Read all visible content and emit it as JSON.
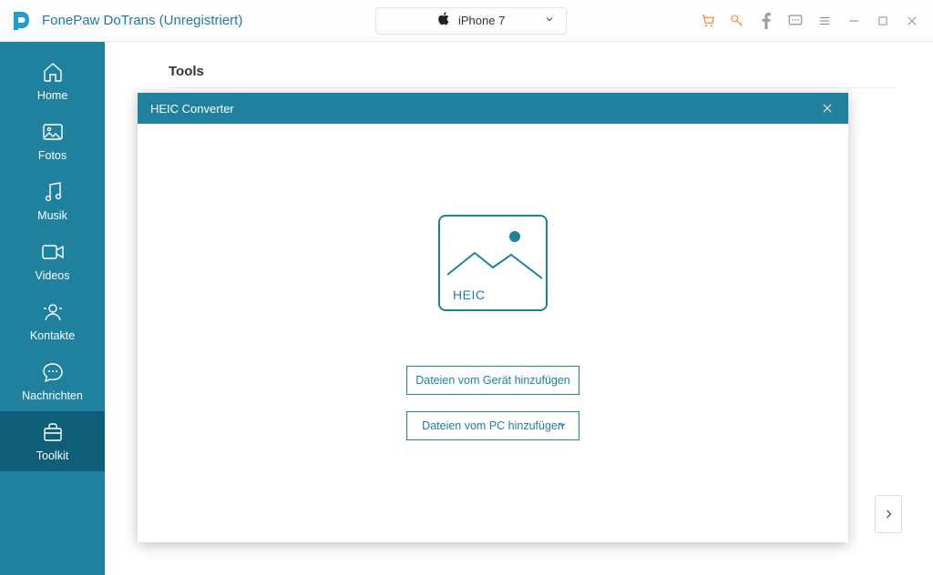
{
  "titlebar": {
    "app_title": "FonePaw DoTrans (Unregistriert)",
    "device_name": "iPhone 7"
  },
  "sidebar": {
    "items": [
      {
        "label": "Home"
      },
      {
        "label": "Fotos"
      },
      {
        "label": "Musik"
      },
      {
        "label": "Videos"
      },
      {
        "label": "Kontakte"
      },
      {
        "label": "Nachrichten"
      },
      {
        "label": "Toolkit"
      }
    ]
  },
  "content": {
    "tools_heading": "Tools"
  },
  "modal": {
    "title": "HEIC Converter",
    "heic_label": "HEIC",
    "btn_device": "Dateien vom Gerät hinzufügen",
    "btn_pc": "Dateien vom PC hinzufügen"
  }
}
